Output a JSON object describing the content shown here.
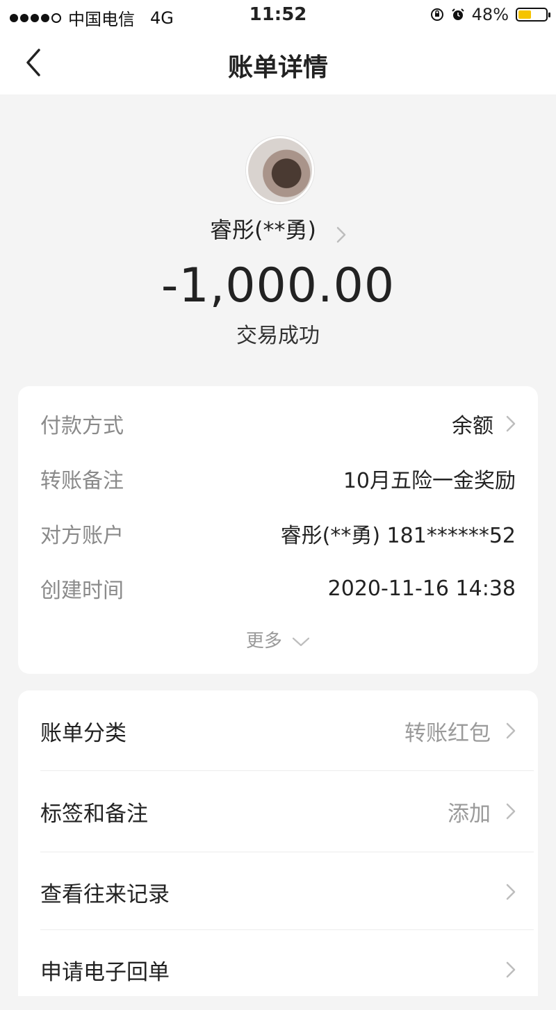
{
  "status_bar": {
    "carrier": "中国电信",
    "network": "4G",
    "time": "11:52",
    "battery_percent": "48%",
    "battery_level": 0.48,
    "icons": [
      "signal-dots",
      "orientation-lock-icon",
      "alarm-icon",
      "battery-icon"
    ]
  },
  "nav": {
    "title": "账单详情",
    "back_icon": "chevron-left-icon"
  },
  "header": {
    "name": "睿彤(**勇)",
    "amount": "-1,000.00",
    "status": "交易成功"
  },
  "details": {
    "rows": [
      {
        "label": "付款方式",
        "value": "余额"
      },
      {
        "label": "转账备注",
        "value": "10月五险一金奖励"
      },
      {
        "label": "对方账户",
        "value": "睿彤(**勇) 181******52"
      },
      {
        "label": "创建时间",
        "value": "2020-11-16 14:38"
      }
    ],
    "more": "更多"
  },
  "actions": {
    "items": [
      {
        "label": "账单分类",
        "value": "转账红包"
      },
      {
        "label": "标签和备注",
        "value": "添加"
      },
      {
        "label": "查看往来记录",
        "value": ""
      },
      {
        "label": "申请电子回单",
        "value": ""
      }
    ]
  },
  "colors": {
    "background": "#f4f4f4",
    "card": "#ffffff",
    "battery": "#f5c400",
    "muted_text": "#8a8a8a"
  }
}
